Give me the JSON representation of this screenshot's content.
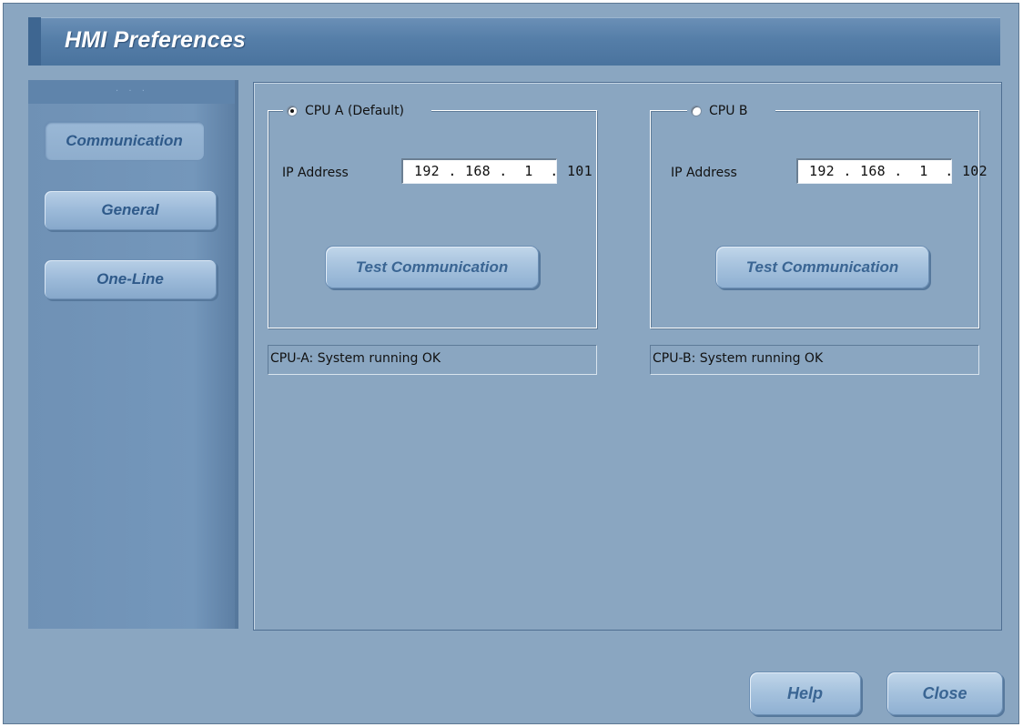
{
  "window": {
    "title": "HMI Preferences"
  },
  "sidebar": {
    "items": [
      {
        "label": "Communication",
        "active": true
      },
      {
        "label": "General",
        "active": false
      },
      {
        "label": "One-Line",
        "active": false
      }
    ]
  },
  "cpu_a": {
    "label": "CPU A (Default)",
    "selected": true,
    "ip_label": "IP Address",
    "ip_value": "192 . 168 .  1  . 101",
    "test_button": "Test Communication",
    "status": "CPU-A: System running OK"
  },
  "cpu_b": {
    "label": "CPU B",
    "selected": false,
    "ip_label": "IP Address",
    "ip_value": "192 . 168 .  1  . 102",
    "test_button": "Test Communication",
    "status": "CPU-B: System running OK"
  },
  "footer": {
    "help_label": "Help",
    "close_label": "Close"
  },
  "colors": {
    "window_bg": "#8aa6c1",
    "title_bar": "#557ea8",
    "button_text": "#3a6593"
  }
}
